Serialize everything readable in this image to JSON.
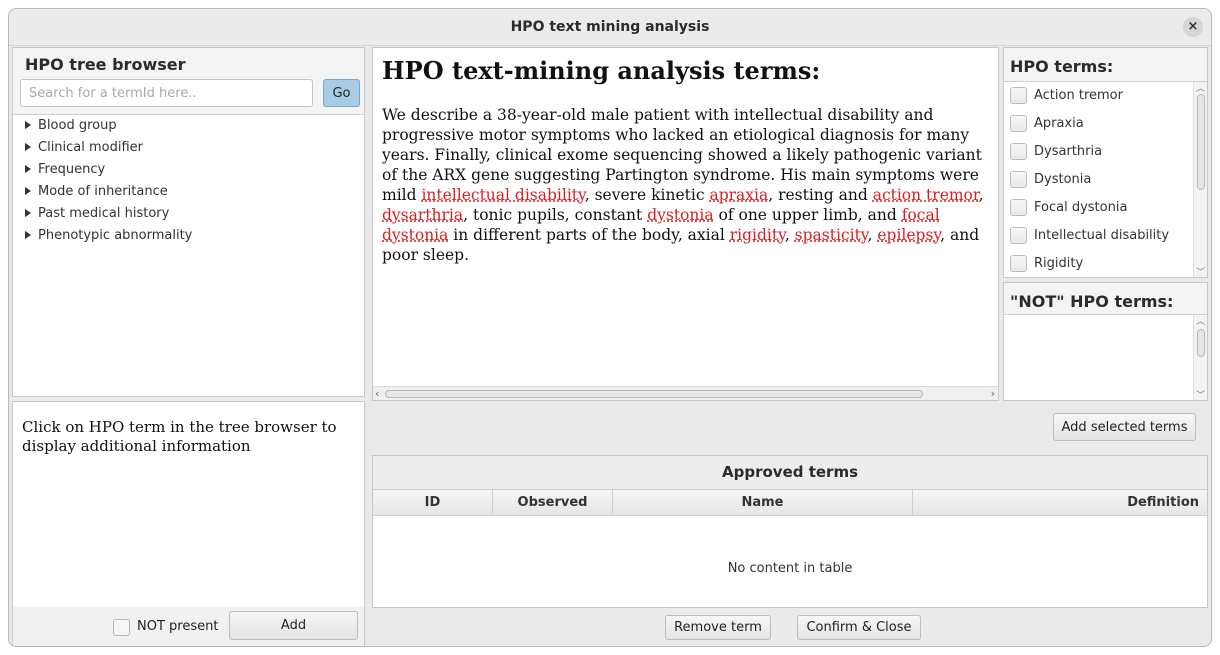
{
  "window": {
    "title": "HPO text mining analysis",
    "close_symbol": "×"
  },
  "tree_browser": {
    "title": "HPO tree browser",
    "search_placeholder": "Search for a termId here..",
    "go_label": "Go",
    "items": [
      {
        "label": "Blood group"
      },
      {
        "label": "Clinical modifier"
      },
      {
        "label": "Frequency"
      },
      {
        "label": "Mode of inheritance"
      },
      {
        "label": "Past medical history"
      },
      {
        "label": "Phenotypic abnormality"
      }
    ]
  },
  "info_panel": {
    "text": "Click on HPO term in the tree browser to display additional information",
    "not_present_label": "NOT present",
    "add_label": "Add"
  },
  "analysis": {
    "title": "HPO text-mining analysis terms:",
    "segments": [
      {
        "text": "We describe a 38-year-old male patient with intellectual disability and progressive motor symptoms who lacked an etiological diagnosis for many years. Finally, clinical exome sequencing showed a likely pathogenic variant of the ARX gene suggesting Partington syndrome. His main symptoms were mild ",
        "term": false
      },
      {
        "text": "intellectual disability",
        "term": true
      },
      {
        "text": ", severe kinetic ",
        "term": false
      },
      {
        "text": "apraxia",
        "term": true
      },
      {
        "text": ", resting and ",
        "term": false
      },
      {
        "text": "action tremor",
        "term": true
      },
      {
        "text": ", ",
        "term": false
      },
      {
        "text": "dysarthria",
        "term": true
      },
      {
        "text": ", tonic pupils, constant ",
        "term": false
      },
      {
        "text": "dystonia",
        "term": true
      },
      {
        "text": " of one upper limb, and ",
        "term": false
      },
      {
        "text": "focal dystonia",
        "term": true
      },
      {
        "text": " in different parts of the body, axial ",
        "term": false
      },
      {
        "text": "rigidity",
        "term": true
      },
      {
        "text": ", ",
        "term": false
      },
      {
        "text": "spasticity",
        "term": true
      },
      {
        "text": ", ",
        "term": false
      },
      {
        "text": "epilepsy",
        "term": true
      },
      {
        "text": ", and poor sleep.",
        "term": false
      }
    ]
  },
  "hpo_terms": {
    "title": "HPO terms:",
    "items": [
      {
        "label": "Action tremor"
      },
      {
        "label": "Apraxia"
      },
      {
        "label": "Dysarthria"
      },
      {
        "label": "Dystonia"
      },
      {
        "label": "Focal dystonia"
      },
      {
        "label": "Intellectual disability"
      },
      {
        "label": "Rigidity"
      }
    ]
  },
  "not_hpo_terms": {
    "title": "\"NOT\" HPO terms:"
  },
  "add_selected_label": "Add selected terms",
  "approved": {
    "title": "Approved terms",
    "columns": [
      "ID",
      "Observed",
      "Name",
      "Definition"
    ],
    "empty_text": "No content in table"
  },
  "footer": {
    "remove_label": "Remove term",
    "confirm_label": "Confirm & Close"
  },
  "colors": {
    "term_highlight": "#d92020",
    "go_button": "#a8cbe6"
  }
}
